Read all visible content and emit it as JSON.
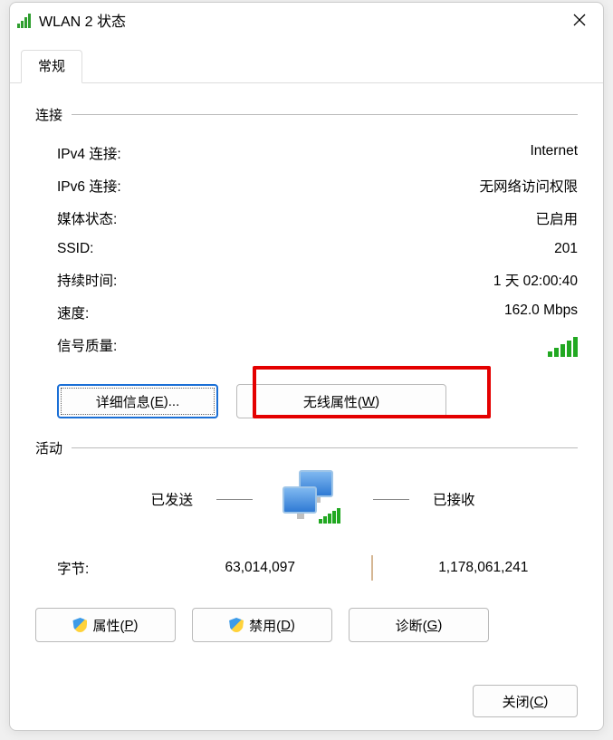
{
  "title": "WLAN 2 状态",
  "tab": "常规",
  "sections": {
    "connection": {
      "header": "连接",
      "ipv4_label": "IPv4 连接:",
      "ipv4_value": "Internet",
      "ipv6_label": "IPv6 连接:",
      "ipv6_value": "无网络访问权限",
      "media_label": "媒体状态:",
      "media_value": "已启用",
      "ssid_label": "SSID:",
      "ssid_value": "201",
      "duration_label": "持续时间:",
      "duration_value": "1 天 02:00:40",
      "speed_label": "速度:",
      "speed_value": "162.0 Mbps",
      "signal_label": "信号质量:"
    },
    "activity": {
      "header": "活动",
      "sent_label": "已发送",
      "received_label": "已接收",
      "bytes_label": "字节:",
      "sent_value": "63,014,097",
      "received_value": "1,178,061,241"
    }
  },
  "buttons": {
    "details_pre": "详细信息(",
    "details_key": "E",
    "details_post": ")...",
    "wireless_pre": "无线属性(",
    "wireless_key": "W",
    "wireless_post": ")",
    "properties_pre": "属性(",
    "properties_key": "P",
    "properties_post": ")",
    "disable_pre": "禁用(",
    "disable_key": "D",
    "disable_post": ")",
    "diagnose_pre": "诊断(",
    "diagnose_key": "G",
    "diagnose_post": ")",
    "close_pre": "关闭(",
    "close_key": "C",
    "close_post": ")"
  }
}
